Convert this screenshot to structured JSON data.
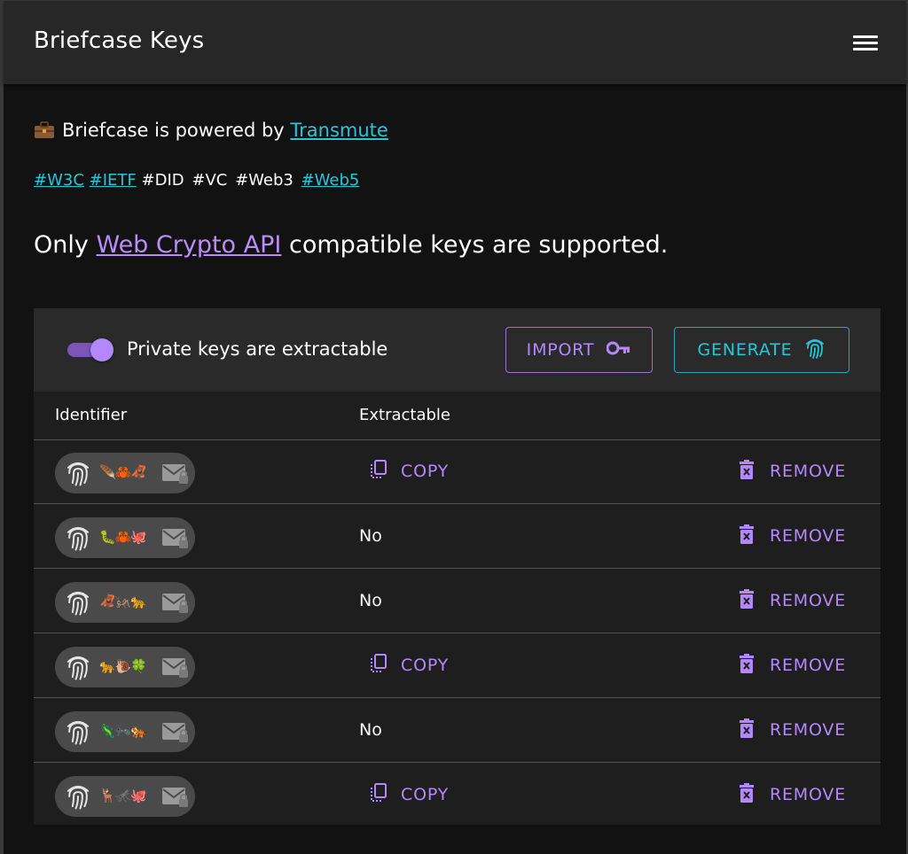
{
  "app": {
    "title": "Briefcase Keys"
  },
  "intro": {
    "powered_prefix": "Briefcase is powered by",
    "powered_link": "Transmute",
    "tags": [
      {
        "text": "#W3C",
        "link": true
      },
      {
        "text": "#IETF",
        "link": true
      },
      {
        "text": "#DID",
        "link": false
      },
      {
        "text": "#VC",
        "link": false
      },
      {
        "text": "#Web3",
        "link": false
      },
      {
        "text": "#Web5",
        "link": true
      }
    ],
    "notice_prefix": "Only",
    "notice_link": "Web Crypto API",
    "notice_suffix": "compatible keys are supported."
  },
  "toolbar": {
    "switch_label": "Private keys are extractable",
    "switch_on": true,
    "import_label": "IMPORT",
    "generate_label": "GENERATE"
  },
  "table": {
    "headers": [
      "Identifier",
      "Extractable"
    ],
    "rows": [
      {
        "emojis": "🪶🦀🦧",
        "extractable": "COPY",
        "copyable": true,
        "action": "REMOVE"
      },
      {
        "emojis": "🐛🦀🐙",
        "extractable": "No",
        "copyable": false,
        "action": "REMOVE"
      },
      {
        "emojis": "🦧🦗🐆",
        "extractable": "No",
        "copyable": false,
        "action": "REMOVE"
      },
      {
        "emojis": "🐆🐌🍀",
        "extractable": "COPY",
        "copyable": true,
        "action": "REMOVE"
      },
      {
        "emojis": "🦎🐜🐅",
        "extractable": "No",
        "copyable": false,
        "action": "REMOVE"
      },
      {
        "emojis": "🦌🦟🐙",
        "extractable": "COPY",
        "copyable": true,
        "action": "REMOVE"
      }
    ]
  },
  "colors": {
    "background": "#121212",
    "appbar": "#272727",
    "accent_purple": "#b388ff",
    "accent_teal": "#26c6da",
    "link_purple": "#ba8cf5",
    "chip": "#4a4a4a"
  },
  "icons": {
    "menu": "hamburger-menu-icon",
    "briefcase": "briefcase-icon",
    "import": "key-icon",
    "generate": "fingerprint-icon",
    "identifier": "fingerprint-icon",
    "mail": "mail-lock-icon",
    "copy": "copy-icon",
    "remove": "trash-icon"
  }
}
